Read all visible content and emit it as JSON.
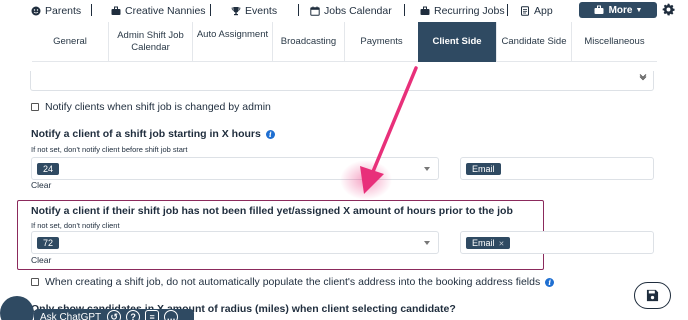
{
  "topnav": {
    "items": [
      {
        "label": "Parents",
        "icon": "smiley-icon"
      },
      {
        "label": "Creative Nannies",
        "icon": "briefcase-icon"
      },
      {
        "label": "Events",
        "icon": "trophy-icon"
      },
      {
        "label": "Jobs Calendar",
        "icon": "calendar-icon"
      },
      {
        "label": "Recurring Jobs",
        "icon": "briefcase-icon"
      },
      {
        "label": "App",
        "icon": "document-icon"
      }
    ],
    "more_label": "More",
    "accent": "#2f4a62"
  },
  "tabs": [
    {
      "label": "General",
      "active": false
    },
    {
      "label": "Admin Shift Job Calendar",
      "active": false
    },
    {
      "label": "Auto Assignment",
      "active": false
    },
    {
      "label": "Broadcasting",
      "active": false
    },
    {
      "label": "Payments",
      "active": false
    },
    {
      "label": "Client Side",
      "active": true
    },
    {
      "label": "Candidate Side",
      "active": false
    },
    {
      "label": "Miscellaneous",
      "active": false
    }
  ],
  "settings": {
    "notify_admin_change_label": "Notify clients when shift job is changed by admin",
    "starting_section": {
      "title": "Notify a client of a shift job starting in X hours",
      "hint": "If not set, don't notify client before shift job start",
      "hours_value": "24",
      "channel_value": "Email",
      "clear_label": "Clear"
    },
    "unfilled_section": {
      "title": "Notify a client if their shift job has not been filled yet/assigned X amount of hours prior to the job",
      "hint": "If not set, don't notify client",
      "hours_value": "72",
      "channel_value": "Email",
      "clear_label": "Clear"
    },
    "address_populate_label": "When creating a shift job, do not automatically populate the client's address into the booking address fields",
    "radius_title": "Only show candidates in X amount of radius (miles) when client selecting candidate?"
  },
  "widget": {
    "label": "Ask ChatGPT"
  },
  "colors": {
    "highlight_border": "#8b2a5c",
    "arrow": "#e8307a",
    "info_blue": "#1f6fd1"
  }
}
